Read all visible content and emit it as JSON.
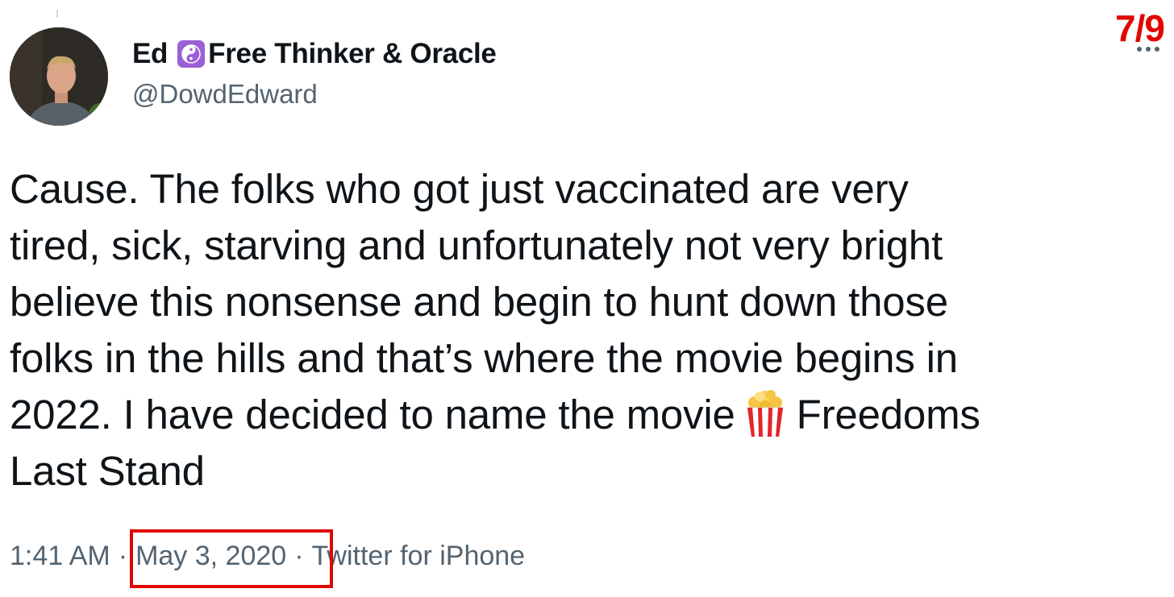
{
  "author": {
    "name": "Ed",
    "name_suffix": "Free Thinker & Oracle",
    "badge_icon": "yin-yang-icon",
    "handle": "@DowdEdward"
  },
  "counter": "7/9",
  "tweet": {
    "lines": [
      "Cause. The folks who got just vaccinated are very",
      "tired, sick, starving and unfortunately not very bright",
      "believe this nonsense and begin to hunt down those",
      "folks in the hills and that’s where the movie begins in",
      "2022. I have decided to name the movie",
      "Last Stand"
    ],
    "line5_after_emoji": "Freedoms",
    "emoji_icon": "popcorn-icon"
  },
  "meta": {
    "time": "1:41 AM",
    "separator": "·",
    "date": "May 3, 2020",
    "source": "Twitter for iPhone"
  },
  "colors": {
    "highlight": "#e10600",
    "secondary_text": "#536471",
    "badge": "#9b5fd6"
  }
}
